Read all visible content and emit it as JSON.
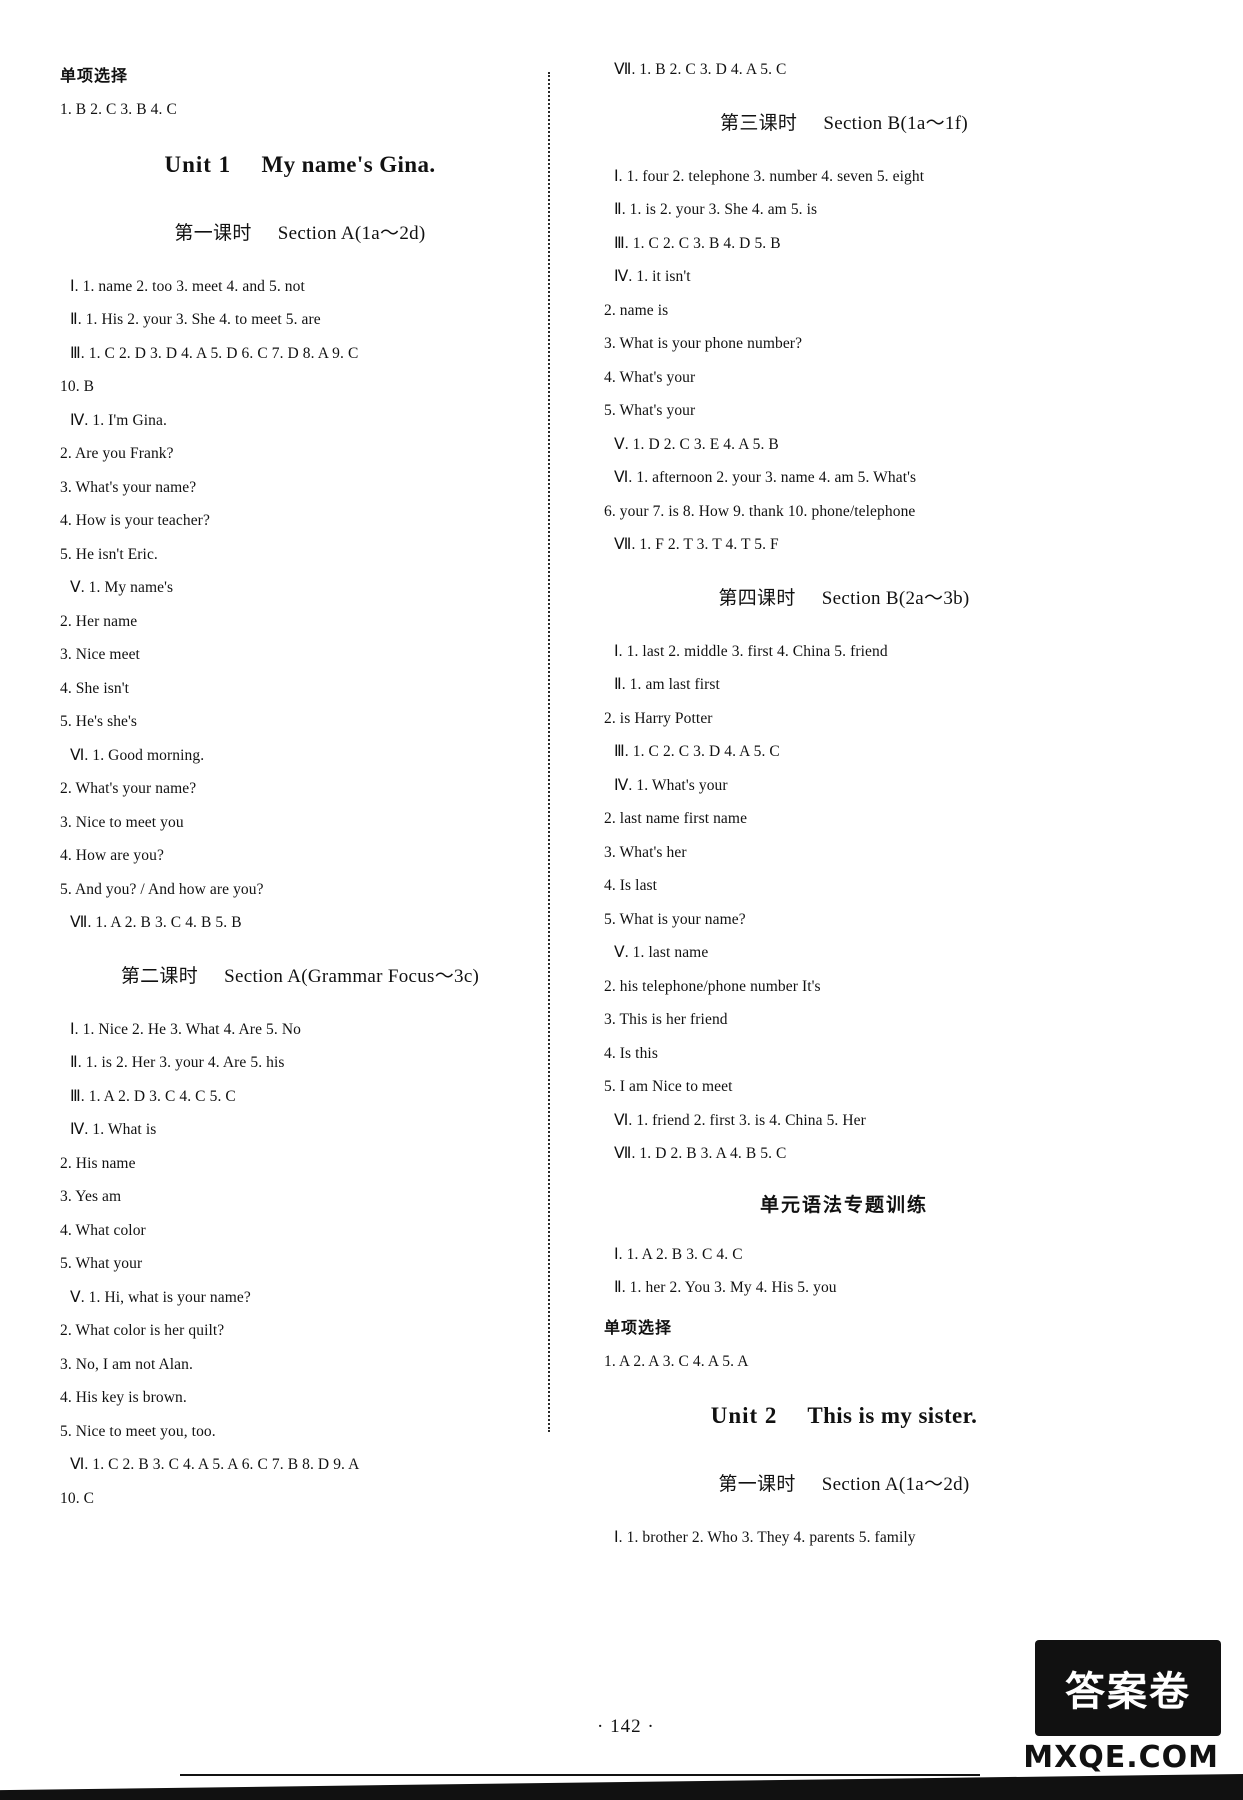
{
  "page": {
    "number": "142",
    "watermark_cn": "答案卷",
    "watermark_url": "MXQE.COM"
  },
  "left_column": {
    "top_section": {
      "heading_cn": "单项选择",
      "answers": "1. B   2. C   3. B   4. C"
    },
    "unit_title": {
      "unit_label": "Unit 1",
      "unit_name": "My name's Gina."
    },
    "lessons": [
      {
        "cn": "第一课时",
        "en": "Section A(1a～2d)",
        "lines": [
          "Ⅰ. 1. name   2. too   3. meet   4. and   5. not",
          "Ⅱ. 1. His   2. your   3. She   4. to meet   5. are",
          "Ⅲ. 1. C   2. D   3. D   4. A   5. D   6. C   7. D   8. A   9. C",
          "10. B",
          "Ⅳ. 1. I'm Gina.",
          "2. Are you Frank?",
          "3. What's your name?",
          "4. How is your teacher?",
          "5. He isn't Eric.",
          "Ⅴ. 1. My   name's",
          "2. Her   name",
          "3. Nice   meet",
          "4. She   isn't",
          "5. He's   she's",
          "Ⅵ. 1. Good morning.",
          "2. What's your name?",
          "3. Nice to meet you",
          "4. How are you?",
          "5. And you? / And how are you?",
          "Ⅶ. 1. A   2. B   3. C   4. B   5. B"
        ]
      },
      {
        "cn": "第二课时",
        "en": "Section A(Grammar Focus～3c)",
        "lines": [
          "Ⅰ. 1. Nice   2. He   3. What   4. Are   5. No",
          "Ⅱ. 1. is   2. Her   3. your   4. Are   5. his",
          "Ⅲ. 1. A   2. D   3. C   4. C   5. C",
          "Ⅳ. 1. What   is",
          "2. His   name",
          "3. Yes   am",
          "4. What   color",
          "5. What   your",
          "Ⅴ. 1. Hi, what is your name?",
          "2. What color is her quilt?",
          "3. No, I am not Alan.",
          "4. His key is brown.",
          "5. Nice to meet you, too.",
          "Ⅵ. 1. C   2. B   3. C   4. A   5. A   6. C   7. B   8. D   9. A",
          "10. C"
        ]
      }
    ]
  },
  "right_column": {
    "top_line": "Ⅶ. 1. B   2. C   3. D   4. A   5. C",
    "lessons": [
      {
        "cn": "第三课时",
        "en": "Section B(1a～1f)",
        "lines": [
          "Ⅰ. 1. four   2. telephone   3. number   4. seven   5. eight",
          "Ⅱ. 1. is   2. your   3. She   4. am   5. is",
          "Ⅲ. 1. C   2. C   3. B   4. D   5. B",
          "Ⅳ. 1. it   isn't",
          "2. name   is",
          "3. What is your phone number?",
          "4. What's   your",
          "5. What's   your",
          "Ⅴ. 1. D   2. C   3. E   4. A   5. B",
          "Ⅵ. 1. afternoon   2. your   3. name   4. am   5. What's",
          "6. your   7. is   8. How   9. thank   10. phone/telephone",
          "Ⅶ. 1. F   2. T   3. T   4. T   5. F"
        ]
      },
      {
        "cn": "第四课时",
        "en": "Section B(2a～3b)",
        "lines": [
          "Ⅰ. 1. last   2. middle   3. first   4. China   5. friend",
          "Ⅱ. 1. am   last   first",
          "2. is   Harry   Potter",
          "Ⅲ. 1. C   2. C   3. D   4. A   5. C",
          "Ⅳ. 1. What's   your",
          "2. last   name   first   name",
          "3. What's   her",
          "4. Is   last",
          "5. What is your name?",
          "Ⅴ. 1. last   name",
          "2. his   telephone/phone   number   It's",
          "3. This   is   her   friend",
          "4. Is   this",
          "5. I   am   Nice   to   meet",
          "Ⅵ. 1. friend   2. first   3. is   4. China   5. Her",
          "Ⅶ. 1. D   2. B   3. A   4. B   5. C"
        ]
      }
    ],
    "grammar_section": {
      "title_cn": "单元语法专题训练",
      "lines": [
        "Ⅰ. 1. A   2. B   3. C   4. C",
        "Ⅱ. 1. her   2. You   3. My   4. His   5. you"
      ],
      "heading_cn": "单项选择",
      "choice_answers": "1. A   2. A   3. C   4. A   5. A"
    },
    "unit_title": {
      "unit_label": "Unit 2",
      "unit_name": "This is my sister."
    },
    "last_lesson": {
      "cn": "第一课时",
      "en": "Section A(1a～2d)",
      "lines": [
        "Ⅰ. 1. brother   2. Who   3. They   4. parents   5. family"
      ]
    }
  }
}
